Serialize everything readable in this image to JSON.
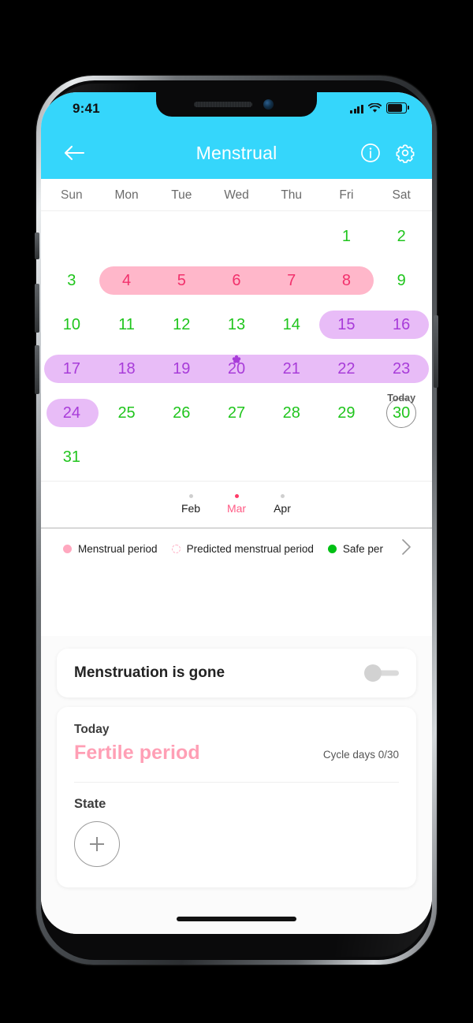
{
  "status_bar": {
    "time": "9:41",
    "signal_icon": "cellular-bars-icon",
    "wifi_icon": "wifi-icon",
    "battery_icon": "battery-full-icon"
  },
  "nav": {
    "back_icon": "back-arrow-icon",
    "title": "Menstrual",
    "info_icon": "info-icon",
    "settings_icon": "gear-icon"
  },
  "calendar": {
    "weekdays": [
      "Sun",
      "Mon",
      "Tue",
      "Wed",
      "Thu",
      "Fri",
      "Sat"
    ],
    "weeks": [
      [
        null,
        null,
        null,
        null,
        null,
        "1",
        "2"
      ],
      [
        "3",
        "4",
        "5",
        "6",
        "7",
        "8",
        "9"
      ],
      [
        "10",
        "11",
        "12",
        "13",
        "14",
        "15",
        "16"
      ],
      [
        "17",
        "18",
        "19",
        "20",
        "21",
        "22",
        "23"
      ],
      [
        "24",
        "25",
        "26",
        "27",
        "28",
        "29",
        "30"
      ],
      [
        "31",
        null,
        null,
        null,
        null,
        null,
        null
      ]
    ],
    "today_label": "Today",
    "today_day": "30",
    "ovulation_day": "20",
    "ovulation_icon": "flower-icon",
    "menstrual_days": [
      "4",
      "5",
      "6",
      "7",
      "8"
    ],
    "fertile_days": [
      "15",
      "16",
      "17",
      "18",
      "19",
      "20",
      "21",
      "22",
      "23",
      "24"
    ],
    "colors": {
      "safe_day_text": "#20c51d",
      "menstrual_text": "#f2316c",
      "menstrual_pill": "#ffb7ca",
      "fertile_text": "#a83cd9",
      "fertile_pill": "#e8bcf7",
      "weekday_text": "#6a6a6a"
    }
  },
  "months": {
    "items": [
      {
        "label": "Feb",
        "active": false
      },
      {
        "label": "Mar",
        "active": true
      },
      {
        "label": "Apr",
        "active": false
      }
    ],
    "active_color": "#ff5b85"
  },
  "legend": {
    "items": [
      {
        "label": "Menstrual period",
        "marker": "filled-pink-dot",
        "color": "#ffa8bf"
      },
      {
        "label": "Predicted menstrual period",
        "marker": "dashed-pink-circle",
        "color": "#ffb3c6"
      },
      {
        "label": "Safe per",
        "marker": "filled-green-dot",
        "color": "#00c014"
      }
    ],
    "more_icon": "chevron-right-icon"
  },
  "toggle_card": {
    "label": "Menstruation is gone",
    "toggle_state": "off"
  },
  "status_card": {
    "today_label": "Today",
    "phase": "Fertile period",
    "phase_color": "#ff9fb5",
    "cycle_days_label": "Cycle days",
    "cycle_days_value": "0/30",
    "state_label": "State",
    "add_icon": "plus-icon"
  },
  "theme": {
    "header": "#35D6FB",
    "page_background": "#fbfbfb"
  }
}
